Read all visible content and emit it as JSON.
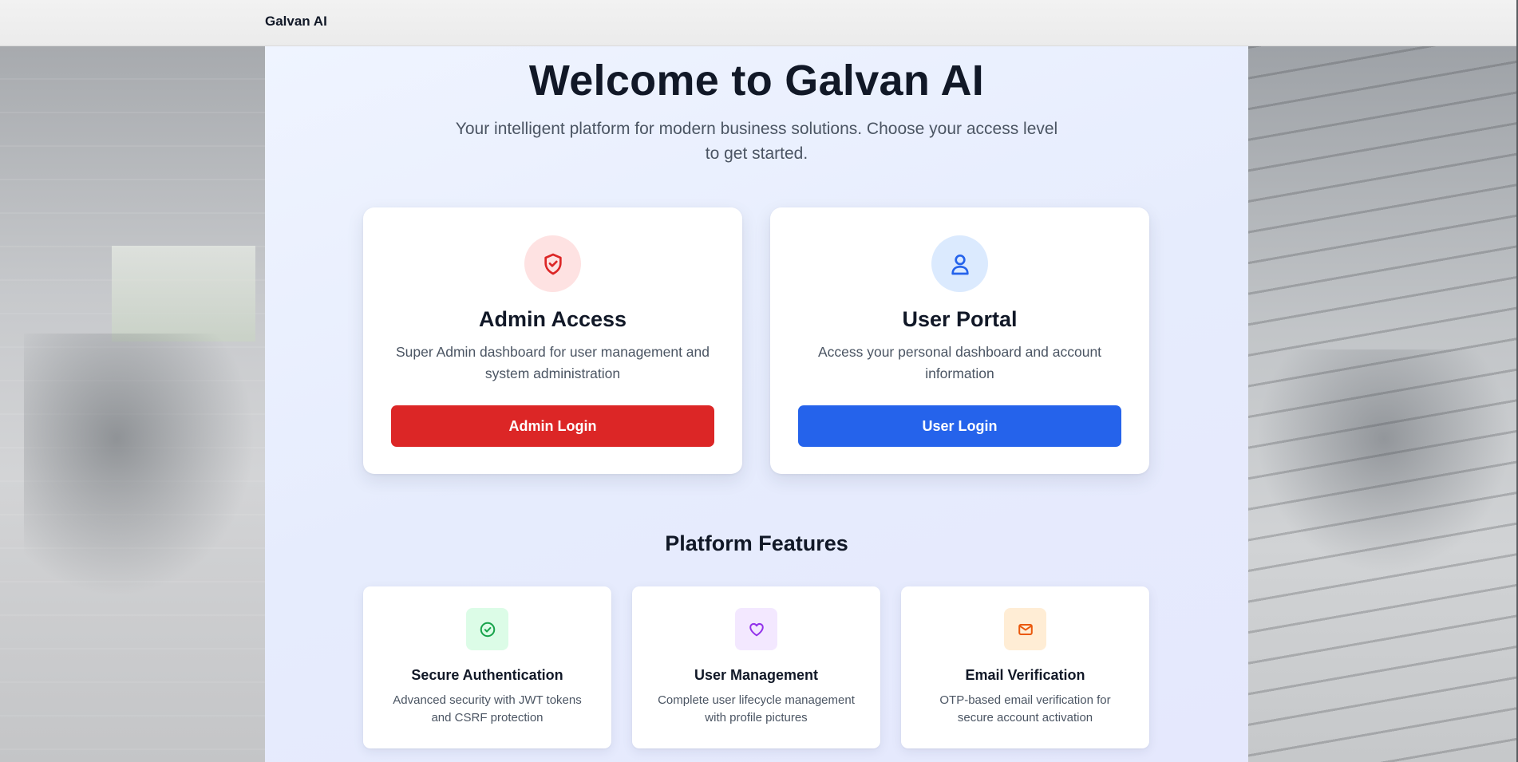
{
  "header": {
    "brand": "Galvan AI"
  },
  "hero": {
    "title": "Welcome to Galvan AI",
    "subtitle": "Your intelligent platform for modern business solutions. Choose your access level to get started."
  },
  "access_cards": [
    {
      "title": "Admin Access",
      "description": "Super Admin dashboard for user management and system administration",
      "button_label": "Admin Login",
      "icon": "shield-check-icon",
      "accent_color": "#dc2626"
    },
    {
      "title": "User Portal",
      "description": "Access your personal dashboard and account information",
      "button_label": "User Login",
      "icon": "user-icon",
      "accent_color": "#2563eb"
    }
  ],
  "features": {
    "title": "Platform Features",
    "items": [
      {
        "title": "Secure Authentication",
        "description": "Advanced security with JWT tokens and CSRF protection",
        "icon": "check-circle-icon",
        "accent_color": "#16a34a"
      },
      {
        "title": "User Management",
        "description": "Complete user lifecycle management with profile pictures",
        "icon": "heart-icon",
        "accent_color": "#9333ea"
      },
      {
        "title": "Email Verification",
        "description": "OTP-based email verification for secure account activation",
        "icon": "mail-icon",
        "accent_color": "#ea580c"
      }
    ]
  }
}
